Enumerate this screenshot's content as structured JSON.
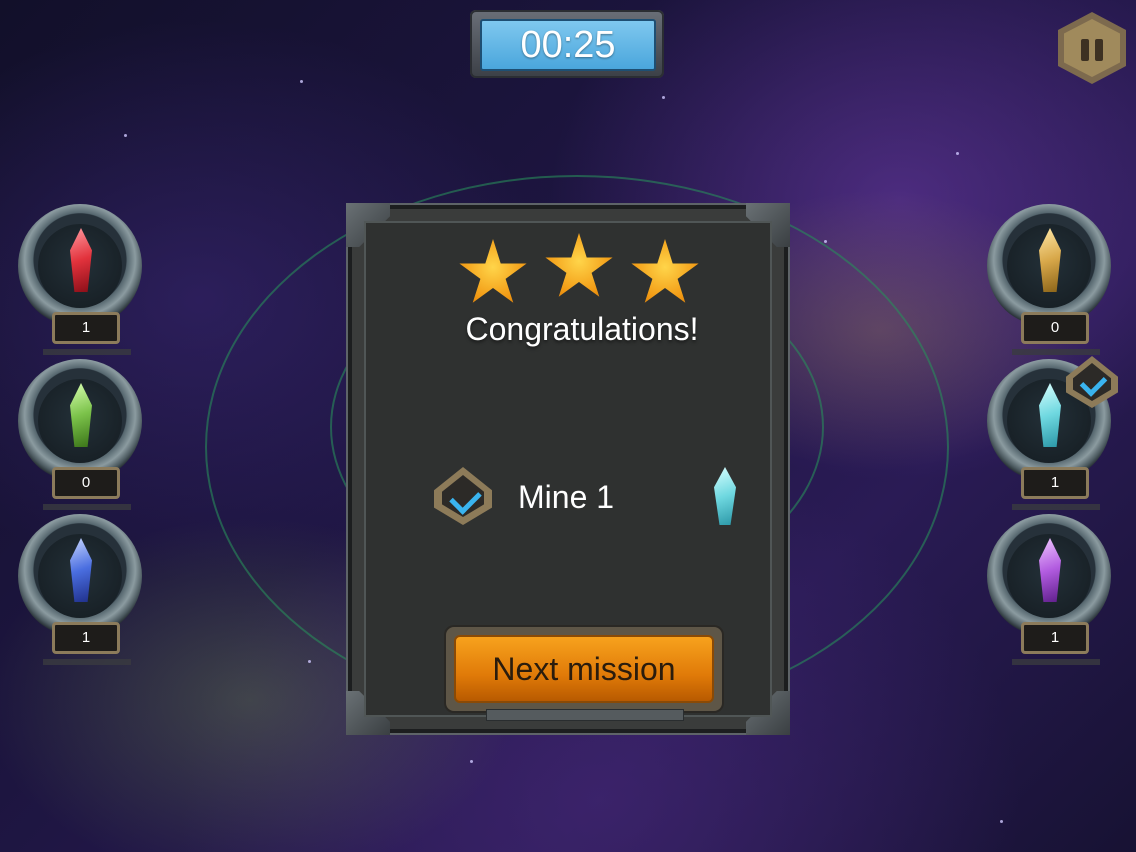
{
  "timer": {
    "value": "00:25"
  },
  "pause": {
    "icon": "pause-icon"
  },
  "crystal_slots_left": [
    {
      "name": "red-crystal",
      "count": "1",
      "color": "#e2323c"
    },
    {
      "name": "green-crystal",
      "count": "0",
      "color": "#7bc24a"
    },
    {
      "name": "blue-crystal",
      "count": "1",
      "color": "#4a6ee0"
    }
  ],
  "crystal_slots_right": [
    {
      "name": "gold-crystal",
      "count": "0",
      "color": "#d8a84a"
    },
    {
      "name": "cyan-crystal",
      "count": "1",
      "color": "#6fd8e0"
    },
    {
      "name": "purple-crystal",
      "count": "1",
      "color": "#b25ce0"
    }
  ],
  "dialog": {
    "stars": 3,
    "title": "Congratulations!",
    "objective": {
      "label": "Mine 1",
      "status_icon": "check-badge-icon",
      "item_icon": "cyan-crystal-icon"
    },
    "button": {
      "label": "Next mission"
    }
  }
}
